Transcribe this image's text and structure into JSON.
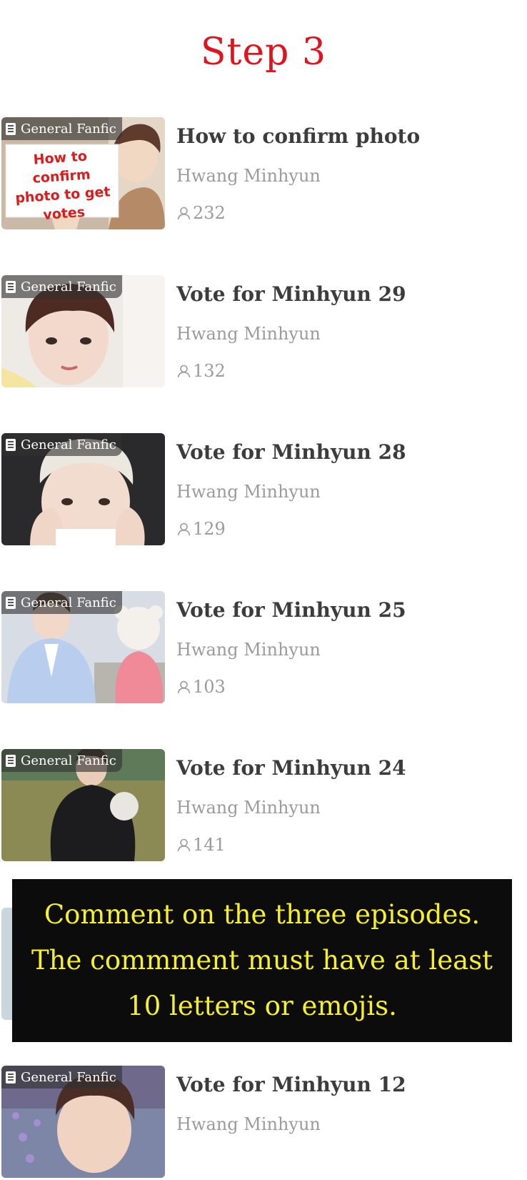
{
  "page_title": "Step 3",
  "tag_label": "General Fanfic",
  "items": [
    {
      "title": "How to confirm photo",
      "author": "Hwang Minhyun",
      "views": "232",
      "sign_text": "How to confirm photo to get votes"
    },
    {
      "title": "Vote for Minhyun 29",
      "author": "Hwang Minhyun",
      "views": "132"
    },
    {
      "title": "Vote for Minhyun 28",
      "author": "Hwang Minhyun",
      "views": "129"
    },
    {
      "title": "Vote for Minhyun 25",
      "author": "Hwang Minhyun",
      "views": "103"
    },
    {
      "title": "Vote for Minhyun 24",
      "author": "Hwang Minhyun",
      "views": "141"
    },
    {
      "title": "Vote for Minhyun 12",
      "author": "Hwang Minhyun"
    }
  ],
  "overlay": {
    "lines": [
      "Comment on the three episodes.",
      "The commment must have at least",
      "10 letters or emojis."
    ]
  },
  "icons": {
    "tag": "document-icon",
    "views": "person-icon"
  },
  "colors": {
    "title_red": "#e0141e",
    "overlay_bg": "#0c0c0c",
    "overlay_text": "#f5f02a",
    "meta_gray": "#9b9b9b",
    "item_title": "#3c3c3c"
  }
}
